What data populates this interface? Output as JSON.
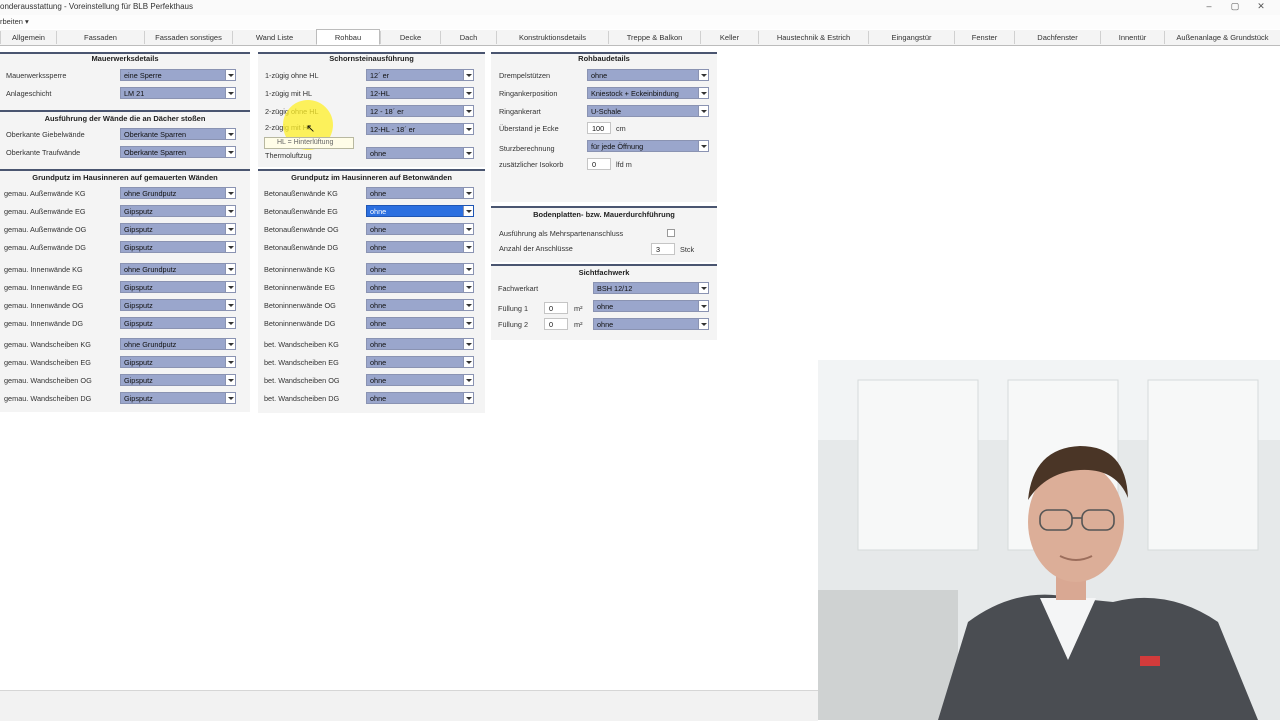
{
  "window": {
    "title": "onderausstattung - Voreinstellung für BLB Perfekthaus",
    "menu": "rbeiten ▾",
    "minimize": "–",
    "maximize": "▢",
    "close": "✕"
  },
  "tabs": [
    "Allgemein",
    "Fassaden",
    "Fassaden sonstiges",
    "Wand Liste",
    "Rohbau",
    "Decke",
    "Dach",
    "Konstruktionsdetails",
    "Treppe & Balkon",
    "Keller",
    "Haustechnik & Estrich",
    "Eingangstür",
    "Fenster",
    "Dachfenster",
    "Innentür",
    "Außenanlage & Grundstück"
  ],
  "active_tab": "Rohbau",
  "panels": {
    "mauerwerk": {
      "title": "Mauerwerksdetails",
      "rows": [
        {
          "label": "Mauerwerkssperre",
          "value": "eine Sperre"
        },
        {
          "label": "Anlageschicht",
          "value": "LM 21"
        }
      ]
    },
    "ausfuehrung": {
      "title": "Ausführung der Wände die an Dächer stoßen",
      "rows": [
        {
          "label": "Oberkante Giebelwände",
          "value": "Oberkante Sparren"
        },
        {
          "label": "Oberkante Traufwände",
          "value": "Oberkante Sparren"
        }
      ]
    },
    "grundputz_gem": {
      "title": "Grundputz im Hausinneren auf gemauerten Wänden",
      "rows": [
        {
          "label": "gemau. Außenwände KG",
          "value": "ohne Grundputz"
        },
        {
          "label": "gemau. Außenwände EG",
          "value": "Gipsputz"
        },
        {
          "label": "gemau. Außenwände OG",
          "value": "Gipsputz"
        },
        {
          "label": "gemau. Außenwände DG",
          "value": "Gipsputz"
        },
        {
          "label": "gemau. Innenwände KG",
          "value": "ohne Grundputz"
        },
        {
          "label": "gemau. Innenwände EG",
          "value": "Gipsputz"
        },
        {
          "label": "gemau. Innenwände OG",
          "value": "Gipsputz"
        },
        {
          "label": "gemau. Innenwände DG",
          "value": "Gipsputz"
        },
        {
          "label": "gemau. Wandscheiben KG",
          "value": "ohne Grundputz"
        },
        {
          "label": "gemau. Wandscheiben EG",
          "value": "Gipsputz"
        },
        {
          "label": "gemau. Wandscheiben OG",
          "value": "Gipsputz"
        },
        {
          "label": "gemau. Wandscheiben DG",
          "value": "Gipsputz"
        }
      ]
    },
    "schornstein": {
      "title": "Schornsteinausführung",
      "rows": [
        {
          "label": "1-zügig ohne HL",
          "value": "12´ er"
        },
        {
          "label": "1-zügig mit HL",
          "value": "12-HL"
        },
        {
          "label": "2-zügig ohne HL",
          "value": "12 - 18´ er"
        },
        {
          "label": "2-zügig mit HL",
          "value": "12-HL - 18´ er"
        },
        {
          "label": "Thermoluftzug",
          "value": "ohne"
        }
      ],
      "tooltip": "HL = Hinterlüftung"
    },
    "grundputz_beton": {
      "title": "Grundputz im Hausinneren auf Betonwänden",
      "rows": [
        {
          "label": "Betonaußenwände KG",
          "value": "ohne"
        },
        {
          "label": "Betonaußenwände EG",
          "value": "ohne"
        },
        {
          "label": "Betonaußenwände OG",
          "value": "ohne"
        },
        {
          "label": "Betonaußenwände DG",
          "value": "ohne"
        },
        {
          "label": "Betoninnenwände KG",
          "value": "ohne"
        },
        {
          "label": "Betoninnenwände EG",
          "value": "ohne"
        },
        {
          "label": "Betoninnenwände OG",
          "value": "ohne"
        },
        {
          "label": "Betoninnenwände DG",
          "value": "ohne"
        },
        {
          "label": "bet. Wandscheiben KG",
          "value": "ohne"
        },
        {
          "label": "bet. Wandscheiben EG",
          "value": "ohne"
        },
        {
          "label": "bet. Wandscheiben OG",
          "value": "ohne"
        },
        {
          "label": "bet. Wandscheiben DG",
          "value": "ohne"
        }
      ]
    },
    "rohbaudetails": {
      "title": "Rohbaudetails",
      "drempel": {
        "label": "Drempelstützen",
        "value": "ohne"
      },
      "ringanker_pos": {
        "label": "Ringankerposition",
        "value": "Kniestock + Eckeinbindung"
      },
      "ringanker_art": {
        "label": "Ringankerart",
        "value": "U-Schale"
      },
      "ueberstand": {
        "label": "Überstand je Ecke",
        "value": "100",
        "unit": "cm"
      },
      "sturz": {
        "label": "Sturzberechnung",
        "value": "für jede Öffnung"
      },
      "isokorb": {
        "label": "zusätzlicher Isokorb",
        "value": "0",
        "unit": "lfd m"
      }
    },
    "bodenplatte": {
      "title": "Bodenplatten- bzw. Mauerdurchführung",
      "mehrsparten": {
        "label": "Ausführung als Mehrspartenanschluss",
        "checked": false
      },
      "anzahl": {
        "label": "Anzahl der Anschlüsse",
        "value": "3",
        "unit": "Stck"
      }
    },
    "sichtfachwerk": {
      "title": "Sichtfachwerk",
      "fachwerkart": {
        "label": "Fachwerkart",
        "value": "BSH 12/12"
      },
      "fuellung1": {
        "label": "Füllung 1",
        "value": "0",
        "unit": "m²",
        "material": "ohne"
      },
      "fuellung2": {
        "label": "Füllung 2",
        "value": "0",
        "unit": "m²",
        "material": "ohne"
      }
    }
  },
  "selected_field": "Betonaußenwände EG",
  "webcam": {
    "present": true,
    "subject": "presenter-video"
  }
}
